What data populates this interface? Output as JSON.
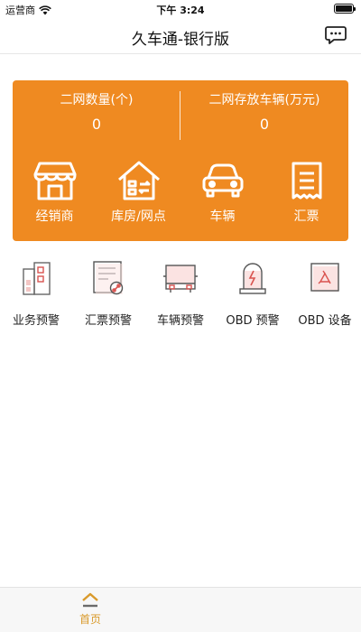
{
  "status_bar": {
    "carrier": "运营商",
    "time": "下午 3:24"
  },
  "nav": {
    "title": "久车通-银行版"
  },
  "stats": [
    {
      "label": "二网数量(个)",
      "value": "0"
    },
    {
      "label": "二网存放车辆(万元)",
      "value": "0"
    }
  ],
  "card_actions": [
    {
      "label": "经销商"
    },
    {
      "label": "库房/网点"
    },
    {
      "label": "车辆"
    },
    {
      "label": "汇票"
    }
  ],
  "grid": [
    {
      "label": "业务预警"
    },
    {
      "label": "汇票预警"
    },
    {
      "label": "车辆预警"
    },
    {
      "label": "OBD 预警"
    },
    {
      "label": "OBD 设备"
    }
  ],
  "tabs": [
    {
      "label": "首页",
      "active": true
    }
  ],
  "colors": {
    "accent": "#ef8a21",
    "tab_active": "#d99a2b",
    "icon_red": "#d9534f"
  }
}
